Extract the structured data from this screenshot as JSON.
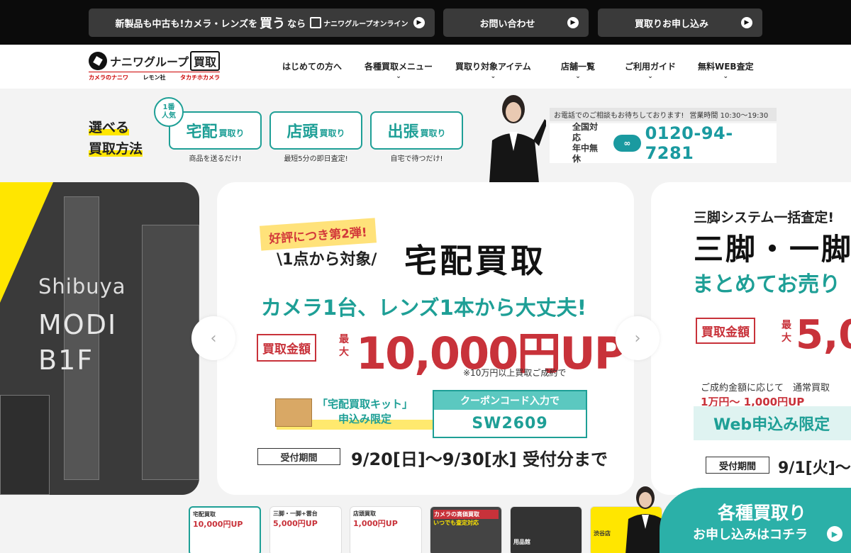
{
  "topbar": {
    "promo_prefix": "新製品も中古も!カメラ・レンズを",
    "promo_big": "買う",
    "promo_suffix": "なら",
    "promo_logo": "ナニワグループオンライン",
    "contact_label": "お問い合わせ",
    "apply_label": "買取りお申し込み"
  },
  "header": {
    "logo_name": "ナニワグループ",
    "logo_kaitori": "買取",
    "sub_brands": [
      "カメラのナニワ",
      "レモン社",
      "タカチホカメラ"
    ],
    "nav": [
      {
        "label": "はじめての方へ",
        "dropdown": false
      },
      {
        "label": "各種買取メニュー",
        "dropdown": true
      },
      {
        "label": "買取り対象アイテム",
        "dropdown": true
      },
      {
        "label": "店舗一覧",
        "dropdown": true
      },
      {
        "label": "ご利用ガイド",
        "dropdown": true
      },
      {
        "label": "無料WEB査定",
        "dropdown": true
      }
    ]
  },
  "methods": {
    "label_line1": "選べる",
    "label_line2": "買取方法",
    "badge": "1番\n人気",
    "items": [
      {
        "main": "宅配",
        "sub": "買取り",
        "caption": "商品を送るだけ!"
      },
      {
        "main": "店頭",
        "sub": "買取り",
        "caption": "最短5分の即日査定!"
      },
      {
        "main": "出張",
        "sub": "買取り",
        "caption": "自宅で待つだけ!"
      }
    ]
  },
  "contact": {
    "bubble_text": "お電話でのご相談もお待ちしております!",
    "hours": "営業時間 10:30〜19:30",
    "area_line1": "全国対応",
    "area_line2": "年中無休",
    "freedial": "fd",
    "phone": "0120-94-7281"
  },
  "carousel": {
    "left_slide": {
      "line1": "Shibuya",
      "line2": "MODI",
      "line3": "B1F"
    },
    "main_slide": {
      "badge": "好評につき第2弾!",
      "from_one": "\\1点から対象/",
      "title": "宅配買取",
      "subtitle": "カメラ1台、レンズ1本から大丈夫!",
      "amount_label": "買取金額",
      "max_label": "最大",
      "amount": "10,000円UP",
      "note": "※10万円以上買取ご成約で",
      "kit_line1": "「宅配買取キット」",
      "kit_line2": "申込み限定",
      "coupon_header": "クーポンコード入力で",
      "coupon_code": "SW2609",
      "period_label": "受付期間",
      "period": "9/20[日]〜9/30[水] 受付分まで"
    },
    "right_slide": {
      "line1": "三脚システム一括査定!",
      "line2": "三脚・一脚",
      "line3": "まとめてお売り",
      "amount_label": "買取金額",
      "max_label": "最大",
      "amount": "5,0",
      "note": "ご成約金額に応じて　通常買取",
      "sub_amount": "1万円〜 1,000円UP",
      "web": "Web申込み限定",
      "period_label": "受付期間",
      "period": "9/1[火]〜"
    },
    "prev_icon": "‹",
    "next_icon": "›"
  },
  "thumbnails": [
    {
      "title": "宅配買取",
      "value": "10,000円UP"
    },
    {
      "title": "三脚・一脚+雲台",
      "value": "5,000円UP"
    },
    {
      "title": "店頭買取",
      "value": "1,000円UP"
    },
    {
      "title": "カメラの高価買取",
      "value": "いつでも査定対応"
    },
    {
      "title": "用品館",
      "value": ""
    },
    {
      "title": "渋谷店",
      "value": ""
    }
  ],
  "cta": {
    "line1": "各種買取り",
    "line2": "お申し込みはコチラ"
  },
  "colors": {
    "teal": "#1e9f96",
    "red": "#c8323a",
    "yellow": "#ffe600"
  }
}
